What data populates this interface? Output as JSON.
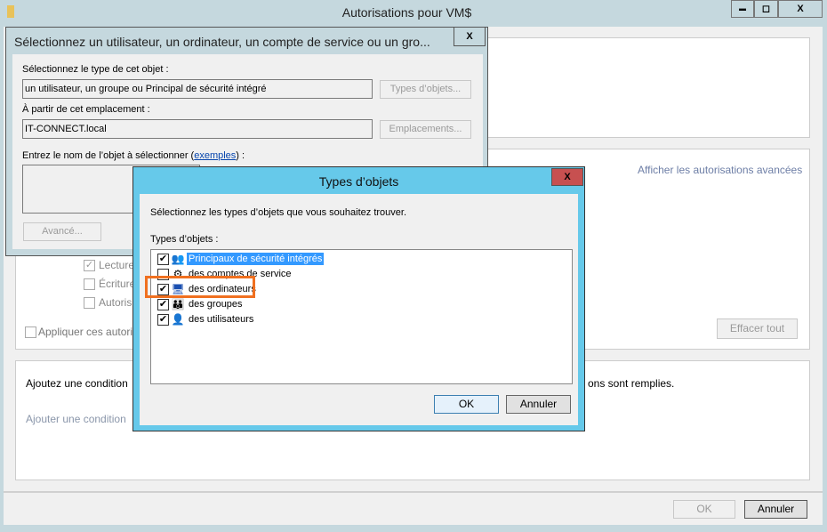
{
  "window": {
    "title": "Autorisations pour VM$",
    "minimize": "▬",
    "maximize": "◻",
    "close": "X",
    "advanced_link": "Afficher les autorisations avancées",
    "perm_read": "Lecture",
    "perm_write": "Écriture",
    "perm_auth": "Autoris",
    "apply_label": "Appliquer ces autori",
    "clear_all": "Effacer tout",
    "condition_text": "Ajoutez une condition",
    "condition_text_end": "ons sont remplies.",
    "add_condition": "Ajouter une condition",
    "ok": "OK",
    "cancel": "Annuler"
  },
  "select_dialog": {
    "title": "Sélectionnez un utilisateur, un ordinateur, un compte de service ou un gro...",
    "close": "X",
    "type_label": "Sélectionnez le type de cet objet :",
    "type_value": "un utilisateur, un groupe ou Principal de sécurité intégré",
    "types_button": "Types d’objets...",
    "location_label": "À partir de cet emplacement :",
    "location_value": "IT-CONNECT.local",
    "locations_button": "Emplacements...",
    "name_label": "Entrez le nom de l’objet à sélectionner (",
    "examples_link": "exemples",
    "name_label_end": ") :",
    "advanced_button": "Avancé..."
  },
  "types_dialog": {
    "title": "Types d’objets",
    "close": "X",
    "instruction": "Sélectionnez les types d’objets que vous souhaitez trouver.",
    "list_label": "Types d’objets :",
    "items": [
      {
        "label": "Principaux de sécurité intégrés",
        "checked": true,
        "icon": "security-principals-icon",
        "selected": true
      },
      {
        "label": "des comptes de service",
        "checked": false,
        "icon": "service-account-icon"
      },
      {
        "label": "des ordinateurs",
        "checked": true,
        "icon": "computer-icon",
        "highlighted": true
      },
      {
        "label": "des groupes",
        "checked": true,
        "icon": "group-icon"
      },
      {
        "label": "des utilisateurs",
        "checked": true,
        "icon": "user-icon"
      }
    ],
    "ok": "OK",
    "cancel": "Annuler",
    "highlight_color": "#f07020",
    "selection_color": "#3399ff"
  }
}
